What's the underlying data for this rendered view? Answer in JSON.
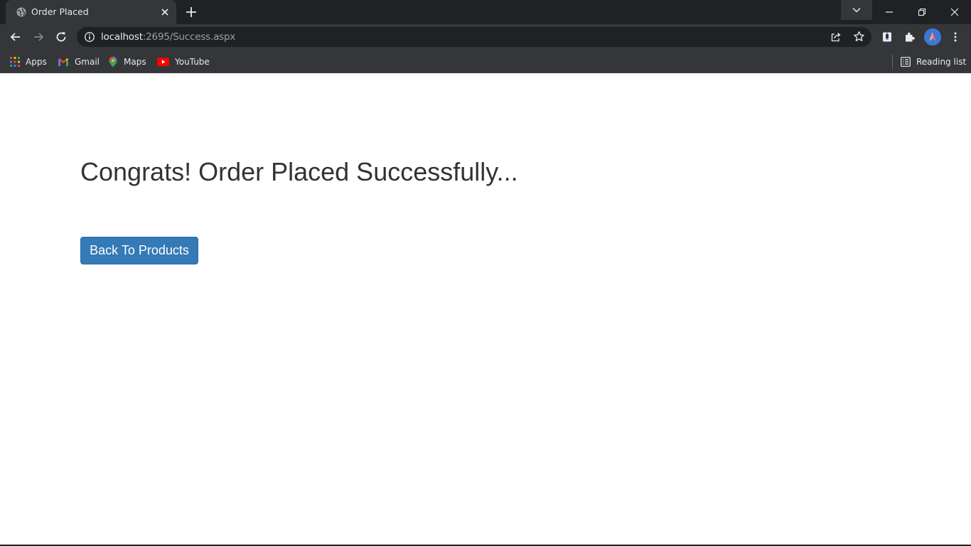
{
  "browser": {
    "tab": {
      "title": "Order Placed"
    },
    "address": {
      "host": "localhost",
      "rest": ":2695/Success.aspx"
    },
    "bookmarks": [
      {
        "label": "Apps",
        "icon": "apps-grid-icon"
      },
      {
        "label": "Gmail",
        "icon": "gmail-icon"
      },
      {
        "label": "Maps",
        "icon": "maps-icon"
      },
      {
        "label": "YouTube",
        "icon": "youtube-icon"
      }
    ],
    "reading_list": "Reading list"
  },
  "page": {
    "headline": "Congrats! Order Placed Successfully...",
    "back_button": "Back To Products"
  },
  "colors": {
    "button": "#337ab7",
    "headline": "#333333",
    "chrome_dark": "#202124",
    "chrome_tab": "#35363a"
  }
}
